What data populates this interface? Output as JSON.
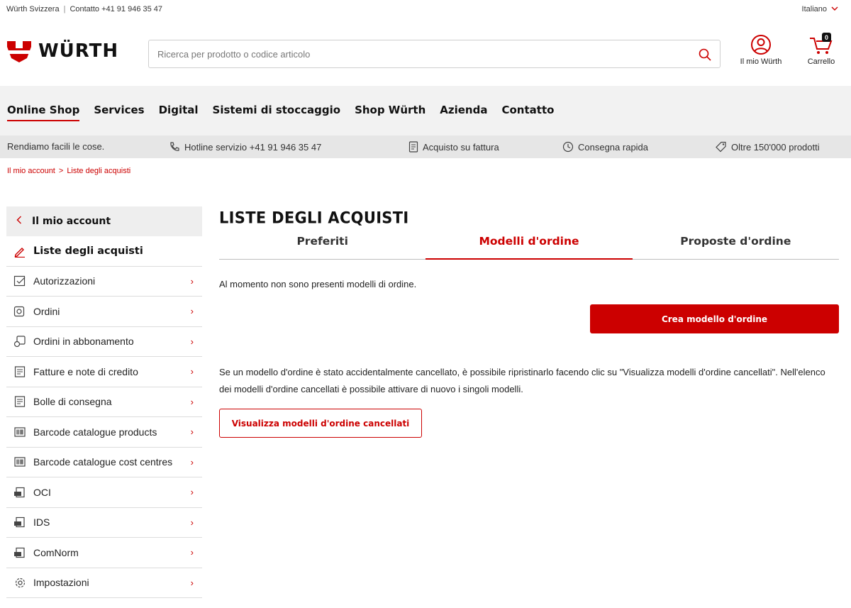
{
  "topbar": {
    "company": "Würth Svizzera",
    "contact": "Contatto +41 91 946 35 47",
    "language": "Italiano"
  },
  "header": {
    "logo_text": "WÜRTH",
    "search_placeholder": "Ricerca per prodotto o codice articolo",
    "account_label": "Il mio Würth",
    "cart_label": "Carrello",
    "cart_count": "0"
  },
  "nav": {
    "items": [
      {
        "label": "Online Shop"
      },
      {
        "label": "Services"
      },
      {
        "label": "Digital"
      },
      {
        "label": "Sistemi di stoccaggio"
      },
      {
        "label": "Shop Würth"
      },
      {
        "label": "Azienda"
      },
      {
        "label": "Contatto"
      }
    ]
  },
  "usp": {
    "slogan": "Rendiamo facili le cose.",
    "hotline": "Hotline servizio +41 91 946 35 47",
    "invoice": "Acquisto su fattura",
    "delivery": "Consegna rapida",
    "products": "Oltre 150'000 prodotti"
  },
  "breadcrumb": {
    "items": [
      "Il mio account",
      "Liste degli acquisti"
    ],
    "separator": ">"
  },
  "sidebar": {
    "header": "Il mio account",
    "current": "Liste degli acquisti",
    "items": [
      {
        "label": "Autorizzazioni",
        "icon": "checklist-icon"
      },
      {
        "label": "Ordini",
        "icon": "order-icon"
      },
      {
        "label": "Ordini in abbonamento",
        "icon": "subscription-icon"
      },
      {
        "label": "Fatture e note di credito",
        "icon": "invoice-icon"
      },
      {
        "label": "Bolle di consegna",
        "icon": "delivery-note-icon"
      },
      {
        "label": "Barcode catalogue products",
        "icon": "barcode-icon"
      },
      {
        "label": "Barcode catalogue cost centres",
        "icon": "barcode-icon"
      },
      {
        "label": "OCI",
        "icon": "edi-icon"
      },
      {
        "label": "IDS",
        "icon": "edi-icon"
      },
      {
        "label": "ComNorm",
        "icon": "edi-icon"
      },
      {
        "label": "Impostazioni",
        "icon": "gear-icon"
      }
    ]
  },
  "main": {
    "title": "LISTE DEGLI ACQUISTI",
    "tabs": [
      {
        "label": "Preferiti"
      },
      {
        "label": "Modelli d'ordine"
      },
      {
        "label": "Proposte d'ordine"
      }
    ],
    "empty_message": "Al momento non sono presenti modelli di ordine.",
    "create_button": "Crea modello d'ordine",
    "info_text": "Se un modello d'ordine è stato accidentalmente cancellato, è possibile ripristinarlo facendo clic su \"Visualizza modelli d'ordine cancellati\". Nell'elenco dei modelli d'ordine cancellati è possibile attivare di nuovo i singoli modelli.",
    "show_deleted_button": "Visualizza modelli d'ordine cancellati"
  },
  "colors": {
    "brand_red": "#cc0000",
    "nav_bg": "#f2f2f2",
    "usp_bg": "#e6e6e6"
  }
}
